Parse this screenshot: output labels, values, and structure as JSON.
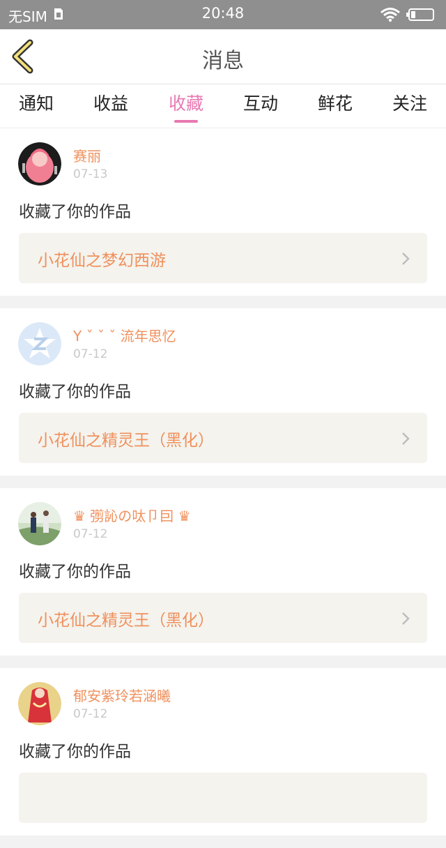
{
  "status_bar": {
    "carrier": "无SIM",
    "time": "20:48"
  },
  "nav": {
    "title": "消息"
  },
  "tabs": [
    {
      "label": "通知"
    },
    {
      "label": "收益"
    },
    {
      "label": "收藏"
    },
    {
      "label": "互动"
    },
    {
      "label": "鲜花"
    },
    {
      "label": "关注"
    }
  ],
  "active_tab": "收藏",
  "colors": {
    "accent": "#e979b2",
    "name": "#f0905c",
    "date": "#c8c8c8",
    "card_work_bg": "#f4f3ee"
  },
  "messages": [
    {
      "name": "赛丽",
      "date": "07-13",
      "action": "收藏了你的作品",
      "work": "小花仙之梦幻西游",
      "avatar_icon": "anime-girl-avatar"
    },
    {
      "name": "Y ˇ ˇ ˇ 流年思忆",
      "date": "07-12",
      "action": "收藏了你的作品",
      "work": "小花仙之精灵王（黑化）",
      "avatar_icon": "default-avatar"
    },
    {
      "name": "♛ 彅訫の呔卩囙 ♛",
      "date": "07-12",
      "action": "收藏了你的作品",
      "work": "小花仙之精灵王（黑化）",
      "avatar_icon": "photo-avatar"
    },
    {
      "name": "郁安紫玲若涵曦",
      "date": "07-12",
      "action": "收藏了你的作品",
      "work": "",
      "avatar_icon": "red-dress-avatar"
    }
  ]
}
